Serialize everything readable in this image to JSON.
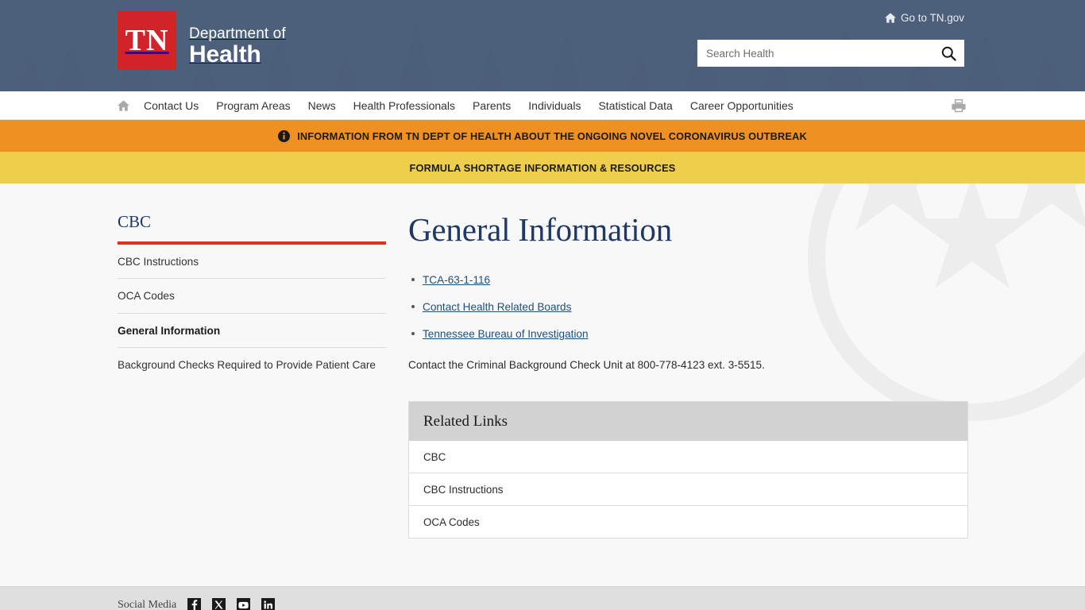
{
  "header": {
    "logo": {
      "mark_text": "TN",
      "dept_line1": "Department of",
      "dept_line2": "Health"
    },
    "tngov_link": "Go to TN.gov",
    "search": {
      "placeholder": "Search Health",
      "value": ""
    }
  },
  "nav": {
    "home_label": "Home",
    "items": [
      {
        "label": "Contact Us"
      },
      {
        "label": "Program Areas"
      },
      {
        "label": "News"
      },
      {
        "label": "Health Professionals"
      },
      {
        "label": "Parents"
      },
      {
        "label": "Individuals"
      },
      {
        "label": "Statistical Data"
      },
      {
        "label": "Career Opportunities"
      }
    ],
    "print_label": "Print"
  },
  "alerts": [
    {
      "text": "INFORMATION FROM TN DEPT OF HEALTH ABOUT THE ONGOING NOVEL CORONAVIRUS OUTBREAK",
      "color": "#ef9022",
      "has_icon": true
    },
    {
      "text": "FORMULA SHORTAGE INFORMATION & RESOURCES",
      "color": "#efce4b",
      "has_icon": false
    }
  ],
  "sidebar": {
    "title": "CBC",
    "items": [
      {
        "label": "CBC Instructions",
        "active": false
      },
      {
        "label": "OCA Codes",
        "active": false
      },
      {
        "label": "General Information",
        "active": true
      },
      {
        "label": "Background Checks Required to Provide Patient Care",
        "active": false
      }
    ]
  },
  "main": {
    "title": "General Information",
    "links": [
      {
        "label": "TCA-63-1-116"
      },
      {
        "label": "Contact Health Related Boards"
      },
      {
        "label": "Tennessee Bureau of Investigation"
      }
    ],
    "contact_text": "Contact the Criminal Background Check Unit at 800-778-4123 ext. 3-5515.",
    "related": {
      "heading": "Related Links",
      "items": [
        {
          "label": "CBC"
        },
        {
          "label": "CBC Instructions"
        },
        {
          "label": "OCA Codes"
        }
      ]
    }
  },
  "footer": {
    "social_label": "Social Media",
    "social": [
      {
        "name": "facebook-icon"
      },
      {
        "name": "twitter-x-icon"
      },
      {
        "name": "youtube-icon"
      },
      {
        "name": "linkedin-icon"
      }
    ]
  },
  "colors": {
    "header_bg": "#4c5f7b",
    "brand_red": "#d2232a",
    "rule_red": "#e03127",
    "title_blue": "#1f3864",
    "link_blue": "#1f4e79",
    "alert_orange": "#ef9022",
    "alert_yellow": "#efce4b",
    "page_bg": "#f8f8f8",
    "card_head_gray": "#d2d2d2"
  }
}
